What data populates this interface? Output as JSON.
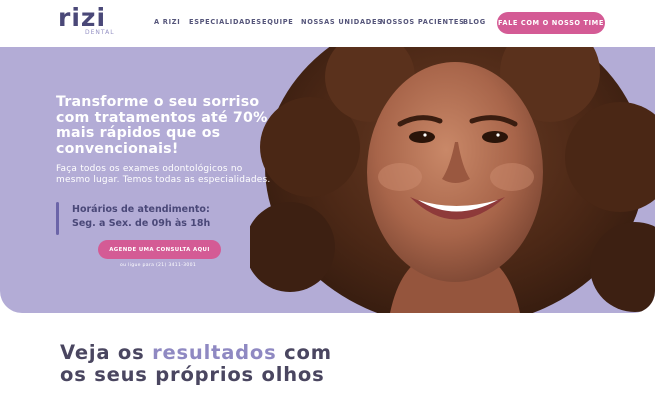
{
  "colors": {
    "brand": "#4a4878",
    "accent_light": "#8f89c2",
    "hero_bg": "#b3acd6",
    "cta": "#d45b95"
  },
  "logo": {
    "word": "rizi",
    "sub": "DENTAL"
  },
  "nav": {
    "items": [
      "A RIZI",
      "ESPECIALIDADES",
      "EQUIPE",
      "NOSSAS UNIDADES",
      "NOSSOS PACIENTES",
      "BLOG"
    ],
    "cta_label": "FALE COM O NOSSO TIME"
  },
  "hero": {
    "title": "Transforme o seu sorriso com tratamentos até 70% mais rápidos que os convencionais!",
    "description": "Faça todos os exames odontológicos no mesmo lugar. Temos todas as especialidades.",
    "hours_label": "Horários de atendimento:",
    "hours_value": "Seg. a Sex. de 09h às 18h",
    "cta_label": "AGENDE UMA CONSULTA AQUI",
    "phone_note": "ou ligue para (21) 3411-3001",
    "photo_icon": "smiling-woman-photo"
  },
  "results": {
    "title_part1": "Veja os ",
    "title_accent": "resultados",
    "title_part2": " com",
    "title_line2": "os seus próprios olhos"
  }
}
